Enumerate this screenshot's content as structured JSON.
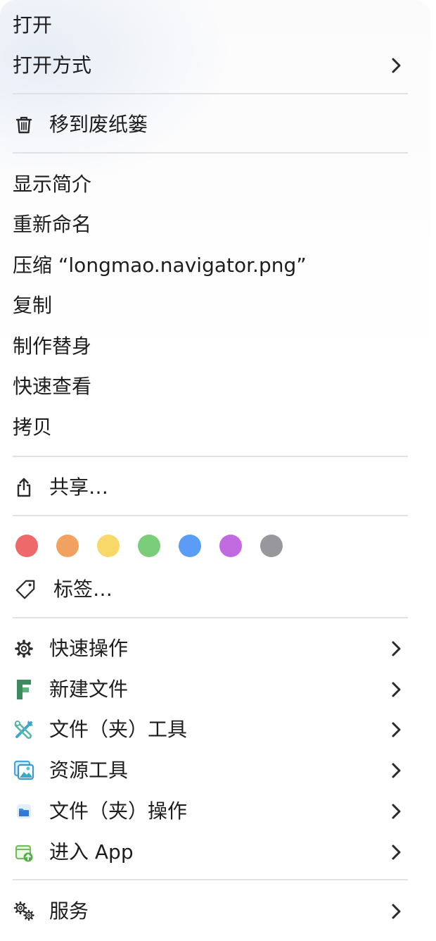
{
  "menu": {
    "open": "打开",
    "open_with": "打开方式",
    "move_to_trash": "移到废纸篓",
    "get_info": "显示简介",
    "rename": "重新命名",
    "compress": "压缩 “longmao.navigator.png”",
    "duplicate": "复制",
    "make_alias": "制作替身",
    "quick_look": "快速查看",
    "copy": "拷贝",
    "share": "共享…",
    "tags": "标签…",
    "quick_actions": "快速操作",
    "new_file": "新建文件",
    "folder_tools": "文件（夹）工具",
    "resource_tools": "资源工具",
    "folder_actions": "文件（夹）操作",
    "open_in_app": "进入 App",
    "services": "服务"
  },
  "tag_colors": [
    {
      "name": "red",
      "color": "#ee6a6a"
    },
    {
      "name": "orange",
      "color": "#f2a260"
    },
    {
      "name": "yellow",
      "color": "#f8d868"
    },
    {
      "name": "green",
      "color": "#7ccd7a"
    },
    {
      "name": "blue",
      "color": "#5b9cf4"
    },
    {
      "name": "purple",
      "color": "#c26be0"
    },
    {
      "name": "gray",
      "color": "#98989c"
    }
  ],
  "icons": {
    "trash": "trash-icon",
    "share": "share-icon",
    "tag": "tag-icon",
    "quick_actions": "gear-icon",
    "new_file": "new-file-app-icon",
    "folder_tools": "tools-icon",
    "resource_tools": "image-icon",
    "folder_actions": "folder-actions-icon",
    "open_in_app": "open-in-app-icon",
    "services": "gears-icon",
    "submenu": "chevron-right-icon"
  }
}
